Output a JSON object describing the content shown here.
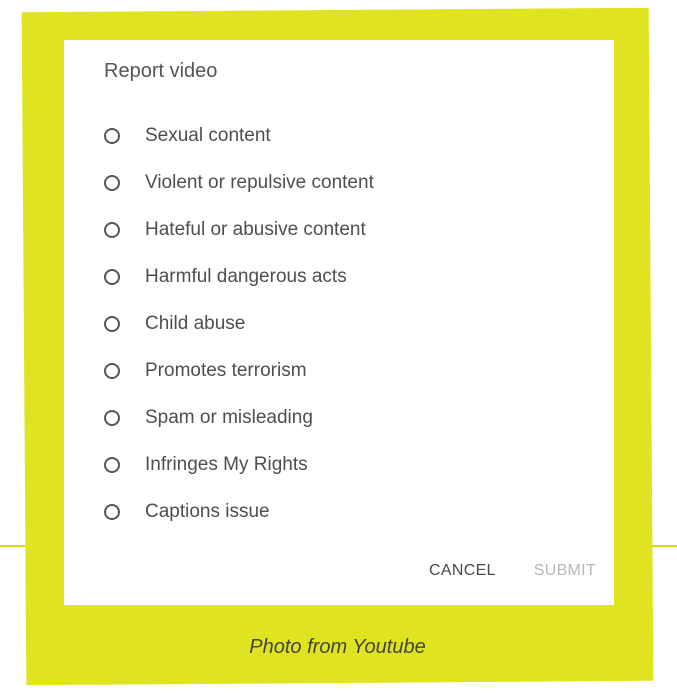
{
  "dialog": {
    "title": "Report video",
    "options": [
      {
        "label": "Sexual content",
        "selected": false
      },
      {
        "label": "Violent or repulsive content",
        "selected": false
      },
      {
        "label": "Hateful or abusive content",
        "selected": false
      },
      {
        "label": "Harmful dangerous acts",
        "selected": false
      },
      {
        "label": "Child abuse",
        "selected": false
      },
      {
        "label": "Promotes terrorism",
        "selected": false
      },
      {
        "label": "Spam or misleading",
        "selected": false
      },
      {
        "label": "Infringes My Rights",
        "selected": false
      },
      {
        "label": "Captions issue",
        "selected": false
      }
    ],
    "cancel_label": "CANCEL",
    "submit_label": "SUBMIT",
    "submit_enabled": false
  },
  "caption": "Photo from Youtube",
  "colors": {
    "frame": "#e0e320",
    "dialog_bg": "#ffffff",
    "text": "#4e4e4e",
    "disabled_text": "#b8b8b8"
  }
}
